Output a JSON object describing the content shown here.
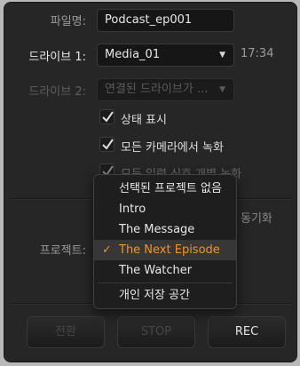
{
  "filename": {
    "label": "파일명:",
    "value": "Podcast_ep001"
  },
  "drive1": {
    "label": "드라이브 1:",
    "value": "Media_01",
    "time": "17:34"
  },
  "drive2": {
    "label": "드라이브 2:",
    "value": "연결된 드라이브가 ..."
  },
  "checkboxes": [
    {
      "label": "상태 표시",
      "checked": true
    },
    {
      "label": "모든 카메라에서 녹화",
      "checked": true
    },
    {
      "label": "모든 입력 신호 개별 녹화",
      "checked": true
    }
  ],
  "partial_label": "동기화",
  "preset": {
    "label": "프로젝트:"
  },
  "dropdown": {
    "items": [
      {
        "label": "선택된 프로젝트 없음"
      },
      {
        "label": "Intro"
      },
      {
        "label": "The Message"
      },
      {
        "label": "The Next Episode",
        "selected": true
      },
      {
        "label": "The Watcher"
      },
      {
        "label": "개인 저장 공간"
      }
    ],
    "check_glyph": "✓"
  },
  "buttons": {
    "switch": "전환",
    "stop": "STOP",
    "rec": "REC"
  },
  "colors": {
    "accent": "#f39322",
    "panel": "#262626",
    "field": "#161616"
  }
}
